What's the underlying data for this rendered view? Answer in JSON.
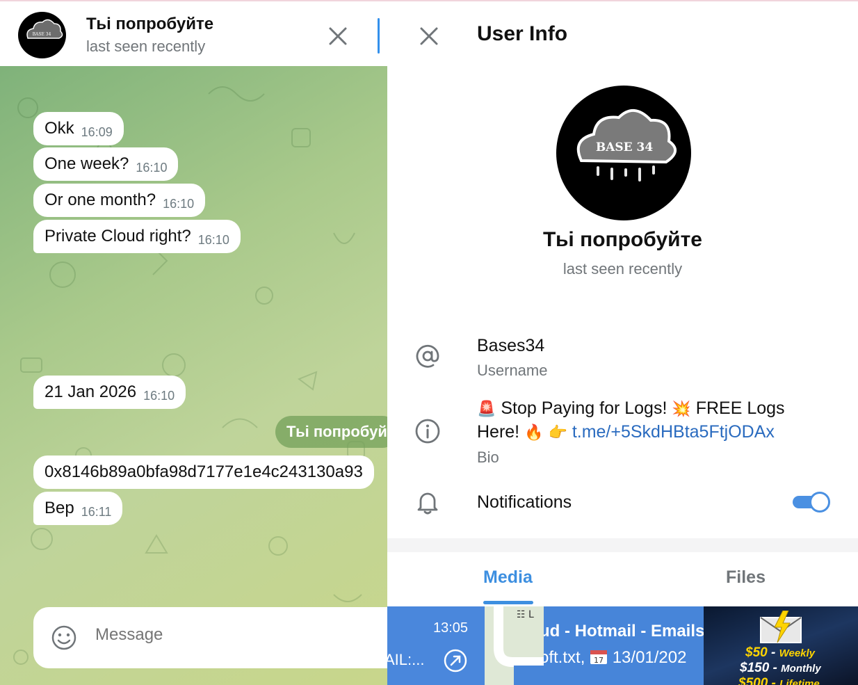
{
  "chat": {
    "title": "Тьі попробуйте",
    "status": "last seen recently",
    "messages": [
      {
        "text": "Okk",
        "time": "16:09"
      },
      {
        "text": "One week?",
        "time": "16:10"
      },
      {
        "text": "Or one month?",
        "time": "16:10"
      },
      {
        "text": "Private Cloud right?",
        "time": "16:10"
      },
      {
        "text": "21 Jan 2026",
        "time": "16:10"
      },
      {
        "text": "0x8146b89a0bfa98d7177e1e4c243130a93",
        "time": ""
      },
      {
        "text": "Вер",
        "time": "16:11"
      }
    ],
    "date_pill": "Тьі попробуй",
    "composer_placeholder": "Message"
  },
  "info": {
    "title": "User Info",
    "name": "Тьі попробуйте",
    "status": "last seen recently",
    "avatar_logo": "BASE 34",
    "username": "Bases34",
    "username_label": "Username",
    "bio_line1_text1": "Stop Paying for Logs!",
    "bio_line1_text2": "FREE Logs",
    "bio_line2_text": "Here!",
    "bio_link": "t.me/+5SkdHBta5FtjODAx",
    "bio_label": "Bio",
    "notifications_label": "Notifications",
    "notifications_on": true,
    "tabs": {
      "media": "Media",
      "files": "Files"
    },
    "media_thumbs": {
      "t1_time": "13:05",
      "t1_text": "AIL:...",
      "t3_line1": "ud - Hotmail - Emails",
      "t3_line2a": "oft.txt,",
      "t3_line2b": "13/01/202",
      "t4_line1_price": "$50",
      "t4_line1_period": "Weekly",
      "t4_line2_price": "$150",
      "t4_line2_period": "Monthly",
      "t4_line3_price": "$500",
      "t4_line3_period": "Lifetime"
    }
  },
  "colors": {
    "accent": "#3390ec",
    "link": "#2a6bbf",
    "muted": "#707579"
  },
  "icons": [
    "close-icon",
    "emoji-icon",
    "at-sign-icon",
    "info-icon",
    "bell-icon",
    "link-icon",
    "calendar-icon",
    "lightning-mail-icon"
  ]
}
